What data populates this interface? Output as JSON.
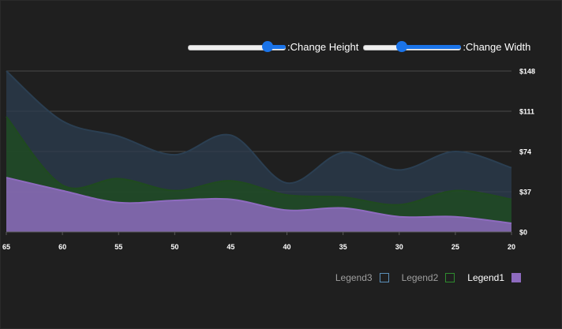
{
  "controls": {
    "height_label": ":Change Height",
    "width_label": ":Change Width",
    "height_value": 0.85,
    "width_value": 0.38
  },
  "chart_data": {
    "type": "area",
    "x": [
      65,
      60,
      55,
      50,
      45,
      40,
      35,
      30,
      25,
      20
    ],
    "xlim": [
      65,
      20
    ],
    "ylim": [
      0,
      148
    ],
    "yticks": [
      "$0",
      "$37",
      "$74",
      "$111",
      "$148"
    ],
    "ytick_values": [
      0,
      37,
      74,
      111,
      148
    ],
    "xticks": [
      "65",
      "60",
      "55",
      "50",
      "45",
      "40",
      "35",
      "30",
      "25",
      "20"
    ],
    "grid": true,
    "legend_position": "bottom-right",
    "series": [
      {
        "name": "Legend1",
        "color": "#8e6bbf",
        "values": [
          50,
          38,
          27,
          29,
          30,
          20,
          22,
          14,
          14,
          8
        ]
      },
      {
        "name": "Legend2",
        "color": "#1e4d1e",
        "values": [
          106,
          43,
          49,
          38,
          47,
          34,
          32,
          25,
          38,
          30
        ]
      },
      {
        "name": "Legend3",
        "color": "#2c3e50",
        "values": [
          148,
          102,
          88,
          71,
          89,
          45,
          73,
          57,
          74,
          59
        ]
      }
    ]
  },
  "legend": {
    "items": [
      {
        "label": "Legend3",
        "border": "#5b8fb9",
        "fill": "transparent",
        "active": false
      },
      {
        "label": "Legend2",
        "border": "#2e8b2e",
        "fill": "transparent",
        "active": false
      },
      {
        "label": "Legend1",
        "border": "#8e6bbf",
        "fill": "#8e6bbf",
        "active": true
      }
    ]
  }
}
